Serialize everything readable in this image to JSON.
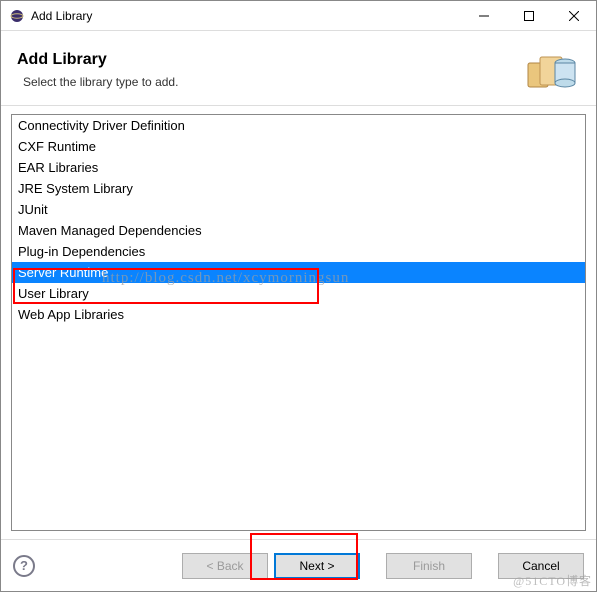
{
  "titlebar": {
    "title": "Add Library"
  },
  "header": {
    "title": "Add Library",
    "description": "Select the library type to add."
  },
  "library_types": [
    {
      "label": "Connectivity Driver Definition",
      "selected": false
    },
    {
      "label": "CXF Runtime",
      "selected": false
    },
    {
      "label": "EAR Libraries",
      "selected": false
    },
    {
      "label": "JRE System Library",
      "selected": false
    },
    {
      "label": "JUnit",
      "selected": false
    },
    {
      "label": "Maven Managed Dependencies",
      "selected": false
    },
    {
      "label": "Plug-in Dependencies",
      "selected": false
    },
    {
      "label": "Server Runtime",
      "selected": true
    },
    {
      "label": "User Library",
      "selected": false
    },
    {
      "label": "Web App Libraries",
      "selected": false
    }
  ],
  "buttons": {
    "back": "< Back",
    "next": "Next >",
    "finish": "Finish",
    "cancel": "Cancel"
  },
  "watermarks": {
    "url": "http://blog.csdn.net/xcymorningsun",
    "attribution": "@51CTO博客"
  }
}
